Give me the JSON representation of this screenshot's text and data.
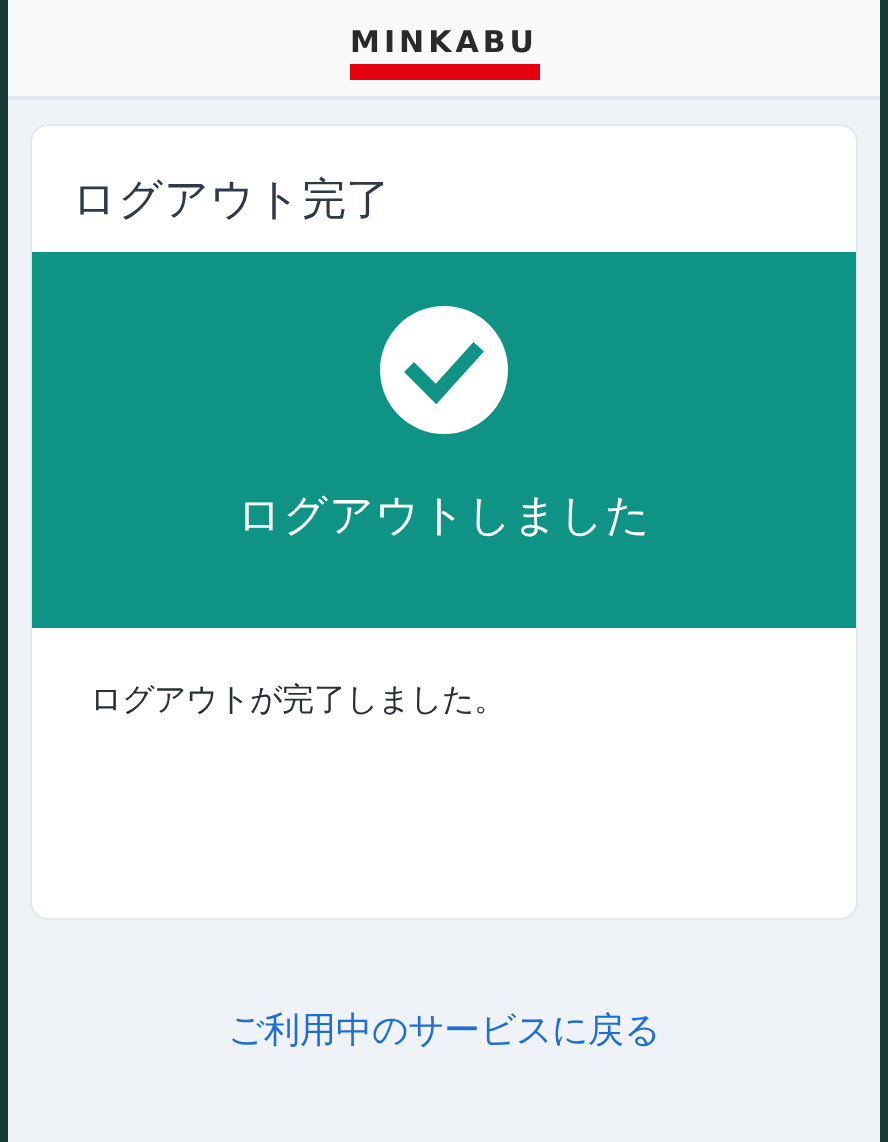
{
  "header": {
    "logo": "MINKABU"
  },
  "card": {
    "title": "ログアウト完了",
    "banner": {
      "kind": "success",
      "message": "ログアウトしました"
    },
    "body": "ログアウトが完了しました。"
  },
  "link": "ご利用中のサービスに戻る"
}
